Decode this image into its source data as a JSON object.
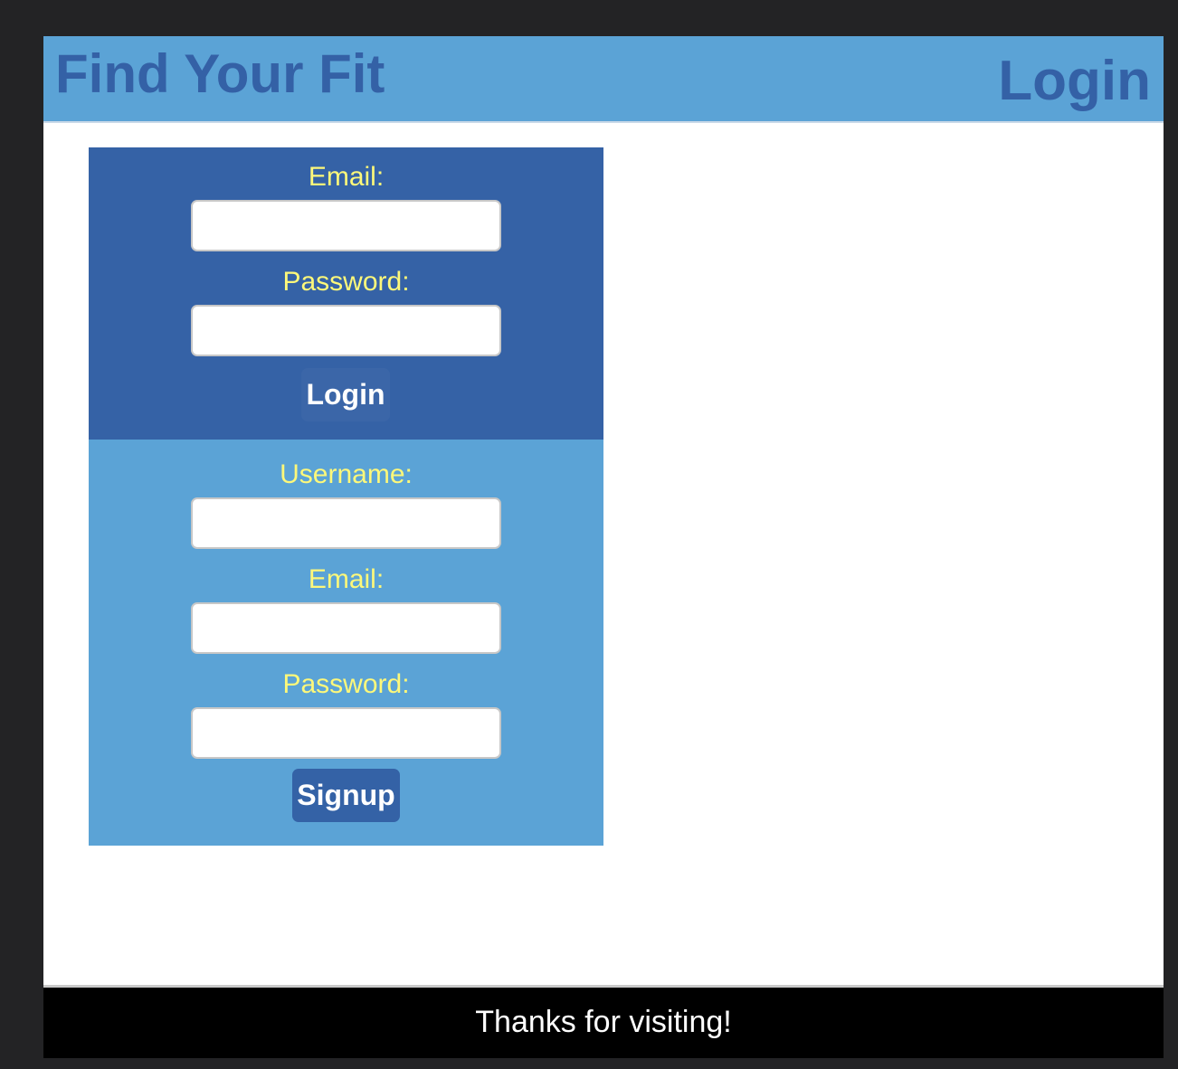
{
  "header": {
    "site_title": "Find Your Fit",
    "page_heading": "Login"
  },
  "login_form": {
    "email_label": "Email:",
    "email_value": "",
    "password_label": "Password:",
    "password_value": "",
    "submit_label": "Login"
  },
  "signup_form": {
    "username_label": "Username:",
    "username_value": "",
    "email_label": "Email:",
    "email_value": "",
    "password_label": "Password:",
    "password_value": "",
    "submit_label": "Signup"
  },
  "footer": {
    "text": "Thanks for visiting!"
  },
  "colors": {
    "header_bg": "#5ba3d6",
    "title_color": "#3461a6",
    "login_panel_bg": "#3562a6",
    "signup_panel_bg": "#5ba3d6",
    "label_color": "#fdf87a",
    "button_bg": "#3462a6",
    "footer_bg": "#000000",
    "page_bg": "#232325"
  }
}
